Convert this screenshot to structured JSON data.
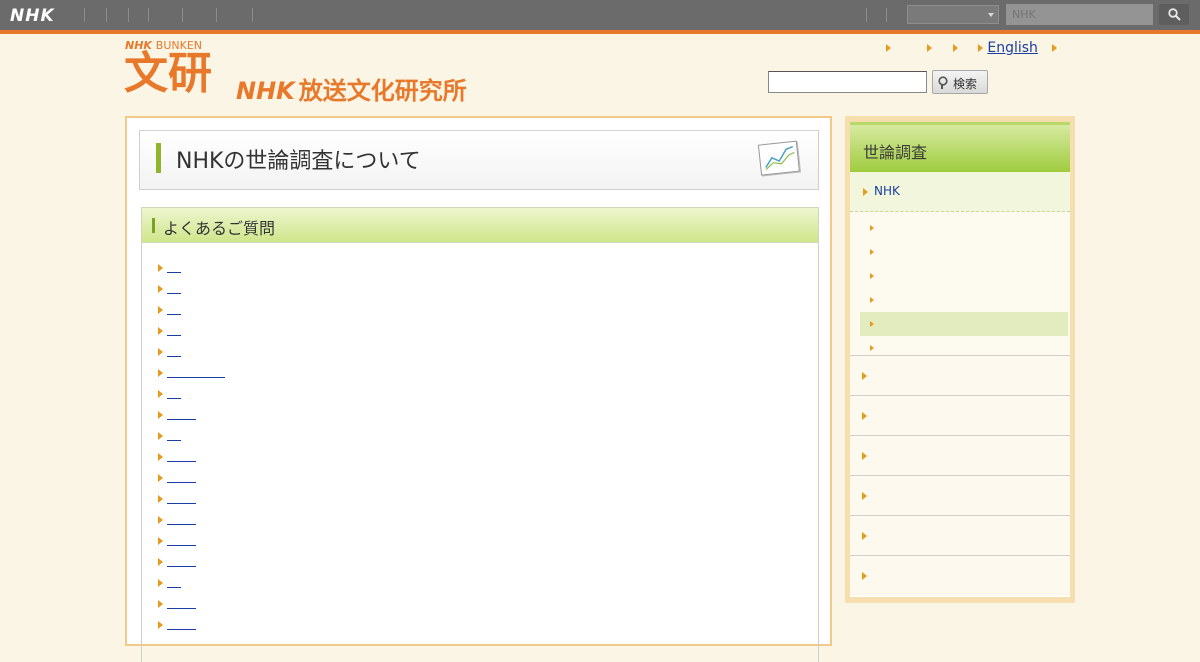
{
  "global_bar": {
    "logo": "NHK",
    "select_value": "",
    "search_placeholder": "NHK"
  },
  "header": {
    "bunken_logo_top": "NHK",
    "bunken_logo_word": "BUNKEN",
    "bunken_kanji": "文研",
    "org_prefix": "NHK",
    "org_name": "放送文化研究所",
    "links": [
      "",
      "",
      "",
      "English"
    ],
    "search_button": "検索",
    "search_value": ""
  },
  "main": {
    "page_title": "NHKの世論調査について",
    "faq_heading": "よくあるご質問",
    "faq_items": [
      {
        "text": ""
      },
      {
        "text": ""
      },
      {
        "text": ""
      },
      {
        "text": ""
      },
      {
        "text": ""
      },
      {
        "text": ""
      },
      {
        "text": ""
      },
      {
        "text": ""
      },
      {
        "text": ""
      },
      {
        "text": ""
      },
      {
        "text": ""
      },
      {
        "text": ""
      },
      {
        "text": ""
      },
      {
        "text": ""
      },
      {
        "text": ""
      },
      {
        "text": ""
      },
      {
        "text": ""
      },
      {
        "text": ""
      }
    ]
  },
  "sidebar": {
    "heading": "世論調査",
    "current_item": "NHK",
    "sub_items": [
      "",
      "",
      "",
      "",
      "",
      ""
    ],
    "active_sub_index": 4,
    "items": [
      "",
      "",
      "",
      "",
      "",
      ""
    ]
  },
  "colors": {
    "accent_orange": "#e8782a",
    "link_blue": "#1a3fa0",
    "green_header": "#9fcc3e",
    "page_bg": "#fbf5e6"
  }
}
